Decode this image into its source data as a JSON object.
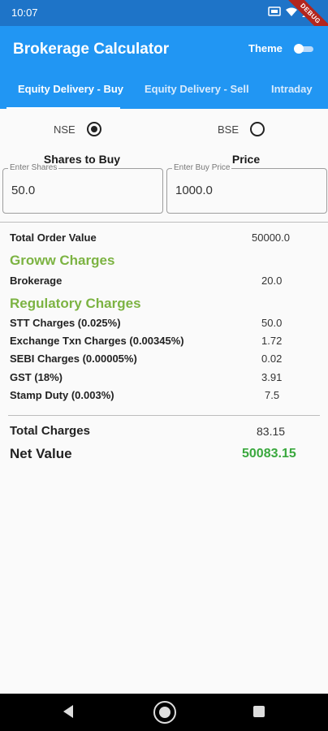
{
  "status_bar": {
    "time": "10:07",
    "debug_banner": "DEBUG"
  },
  "app_bar": {
    "title": "Brokerage Calculator",
    "theme_label": "Theme",
    "theme_toggle_on": false
  },
  "tabs": [
    {
      "label": "Equity Delivery - Buy",
      "active": true
    },
    {
      "label": "Equity Delivery - Sell",
      "active": false
    },
    {
      "label": "Intraday",
      "active": false
    }
  ],
  "exchange": {
    "nse_label": "NSE",
    "bse_label": "BSE",
    "selected": "NSE"
  },
  "inputs": {
    "shares_heading": "Shares to Buy",
    "price_heading": "Price",
    "shares_label": "Enter Shares",
    "shares_value": "50.0",
    "price_label": "Enter Buy Price",
    "price_value": "1000.0"
  },
  "summary": {
    "total_order_label": "Total Order Value",
    "total_order_value": "50000.0",
    "groww_heading": "Groww Charges",
    "brokerage_label": "Brokerage",
    "brokerage_value": "20.0",
    "regulatory_heading": "Regulatory Charges",
    "charges": [
      {
        "label": "STT Charges (0.025%)",
        "value": "50.0"
      },
      {
        "label": "Exchange Txn Charges (0.00345%)",
        "value": "1.72"
      },
      {
        "label": "SEBI Charges (0.00005%)",
        "value": "0.02"
      },
      {
        "label": "GST (18%)",
        "value": "3.91"
      },
      {
        "label": "Stamp Duty (0.003%)",
        "value": "7.5"
      }
    ],
    "total_charges_label": "Total Charges",
    "total_charges_value": "83.15",
    "net_value_label": "Net Value",
    "net_value": "50083.15"
  },
  "colors": {
    "app_bar": "#2196f3",
    "status_bar": "#1e74c8",
    "section_heading": "#7cb342",
    "net_value": "#3aa83e"
  }
}
